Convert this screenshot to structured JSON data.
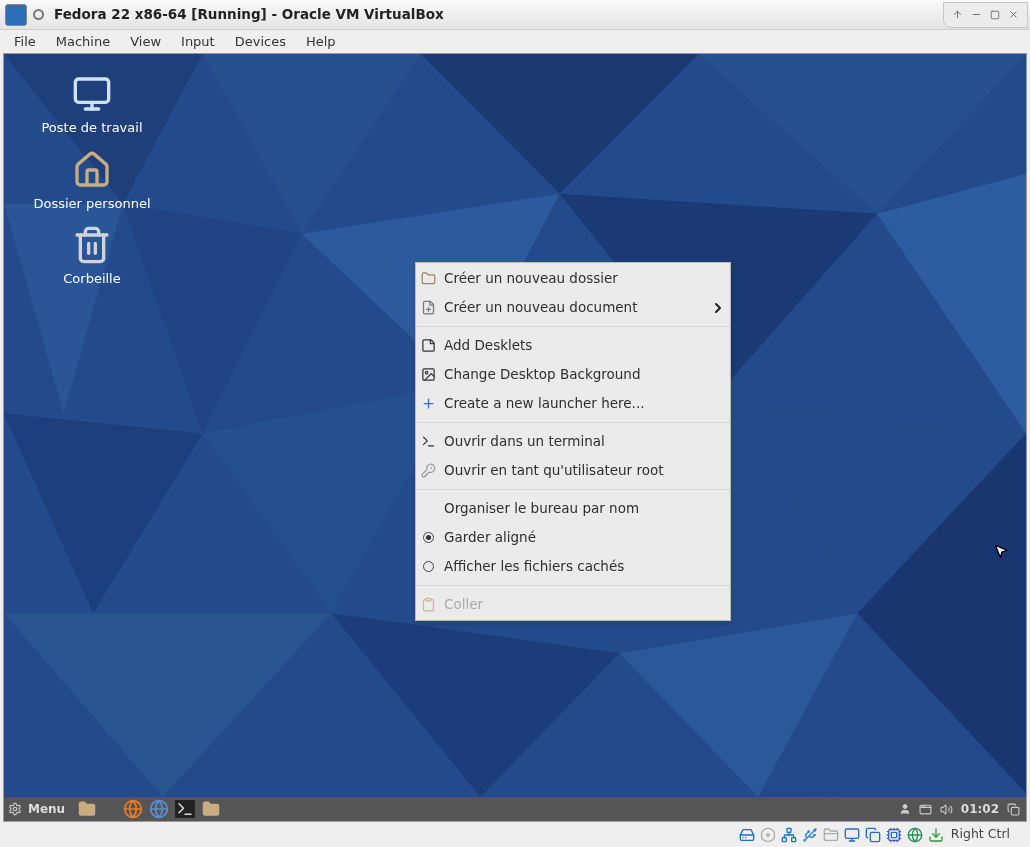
{
  "window": {
    "title": "Fedora 22 x86-64 [Running] - Oracle VM VirtualBox"
  },
  "menu_bar": [
    "File",
    "Machine",
    "View",
    "Input",
    "Devices",
    "Help"
  ],
  "desktop_icons": [
    {
      "label": "Poste de travail"
    },
    {
      "label": "Dossier personnel"
    },
    {
      "label": "Corbeille"
    }
  ],
  "context_menu": {
    "sections": [
      [
        {
          "kind": "action",
          "label": "Créer un nouveau dossier",
          "submenu": false,
          "disabled": false
        },
        {
          "kind": "action",
          "label": "Créer un nouveau document",
          "submenu": true,
          "disabled": false
        }
      ],
      [
        {
          "kind": "action",
          "label": "Add Desklets",
          "submenu": false,
          "disabled": false
        },
        {
          "kind": "action",
          "label": "Change Desktop Background",
          "submenu": false,
          "disabled": false
        },
        {
          "kind": "action",
          "label": "Create a new launcher here...",
          "submenu": false,
          "disabled": false
        }
      ],
      [
        {
          "kind": "action",
          "label": "Ouvrir dans un terminal",
          "submenu": false,
          "disabled": false
        },
        {
          "kind": "action",
          "label": "Ouvrir en tant qu'utilisateur root",
          "submenu": false,
          "disabled": false
        }
      ],
      [
        {
          "kind": "plain",
          "label": "Organiser le bureau par nom",
          "submenu": false,
          "disabled": false
        },
        {
          "kind": "radio",
          "label": "Garder aligné",
          "checked": true,
          "submenu": false,
          "disabled": false
        },
        {
          "kind": "radio",
          "label": "Afficher les fichiers cachés",
          "checked": false,
          "submenu": false,
          "disabled": false
        }
      ],
      [
        {
          "kind": "action",
          "label": "Coller",
          "submenu": false,
          "disabled": true
        }
      ]
    ]
  },
  "taskbar": {
    "menu_label": "Menu",
    "clock": "01:02"
  },
  "status_bar": {
    "host_key": "Right Ctrl"
  }
}
